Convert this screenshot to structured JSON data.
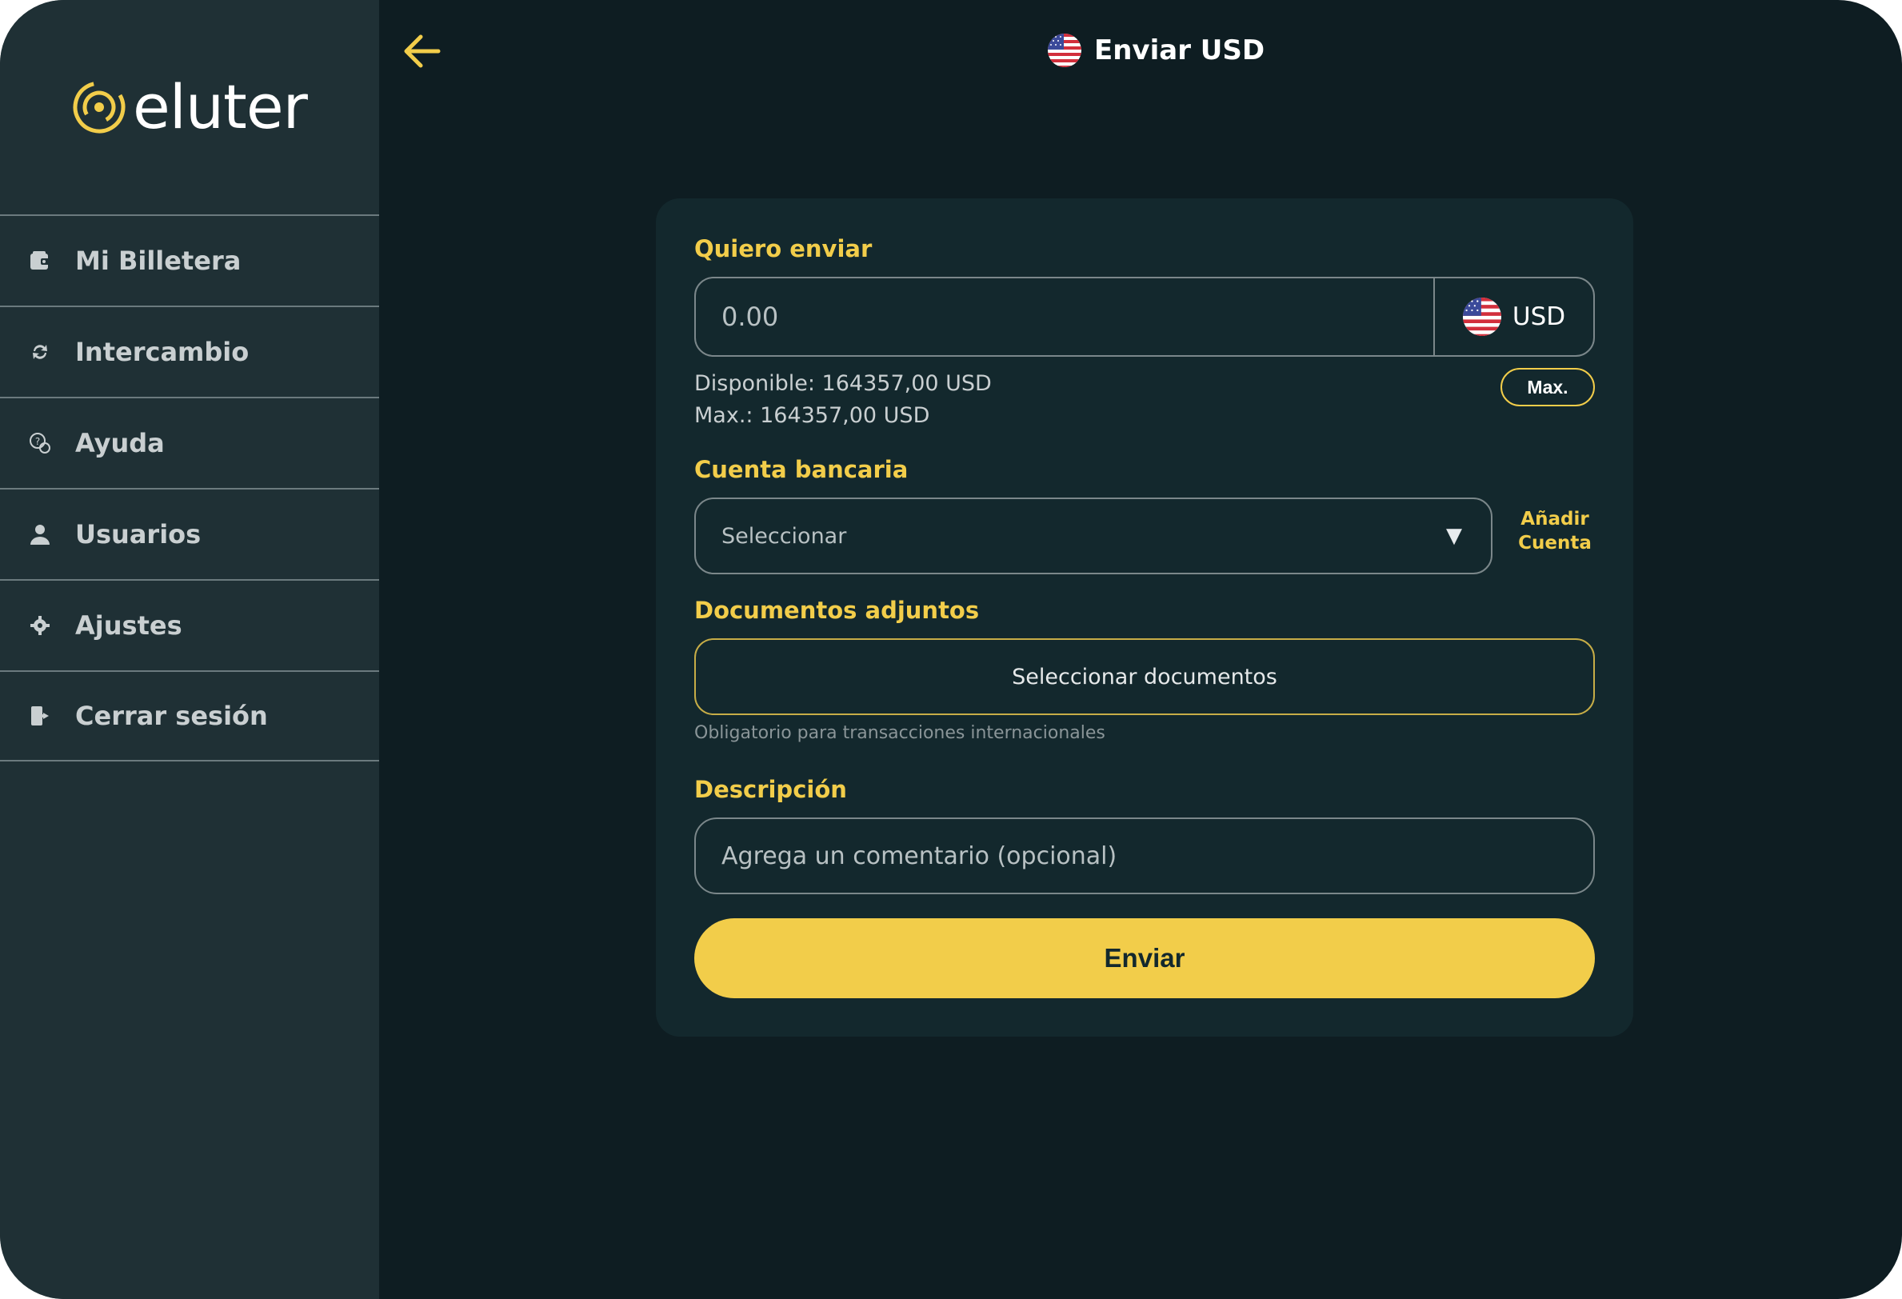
{
  "app": {
    "logo_text": "eluter"
  },
  "sidebar": {
    "items": [
      {
        "label": "Mi Billetera",
        "icon": "wallet-icon"
      },
      {
        "label": "Intercambio",
        "icon": "exchange-icon"
      },
      {
        "label": "Ayuda",
        "icon": "help-icon"
      },
      {
        "label": "Usuarios",
        "icon": "user-icon"
      },
      {
        "label": "Ajustes",
        "icon": "gear-icon"
      },
      {
        "label": "Cerrar sesión",
        "icon": "logout-icon"
      }
    ]
  },
  "header": {
    "title": "Enviar USD",
    "back_icon": "arrow-left-icon",
    "flag_icon": "us-flag-icon"
  },
  "form": {
    "amount_label": "Quiero enviar",
    "amount_placeholder": "0.00",
    "currency": "USD",
    "available_text": "Disponible: 164357,00 USD",
    "max_text": "Max.: 164357,00 USD",
    "max_button": "Max.",
    "bank_label": "Cuenta bancaria",
    "bank_placeholder": "Seleccionar",
    "add_account_line1": "Añadir",
    "add_account_line2": "Cuenta",
    "docs_label": "Documentos adjuntos",
    "docs_button": "Seleccionar documentos",
    "docs_hint": "Obligatorio para transacciones internacionales",
    "description_label": "Descripción",
    "description_placeholder": "Agrega un comentario (opcional)",
    "submit_label": "Enviar"
  },
  "colors": {
    "accent": "#f2cd4a",
    "background": "#0e1d22",
    "sidebar": "#1f3035",
    "card": "#13282d"
  }
}
